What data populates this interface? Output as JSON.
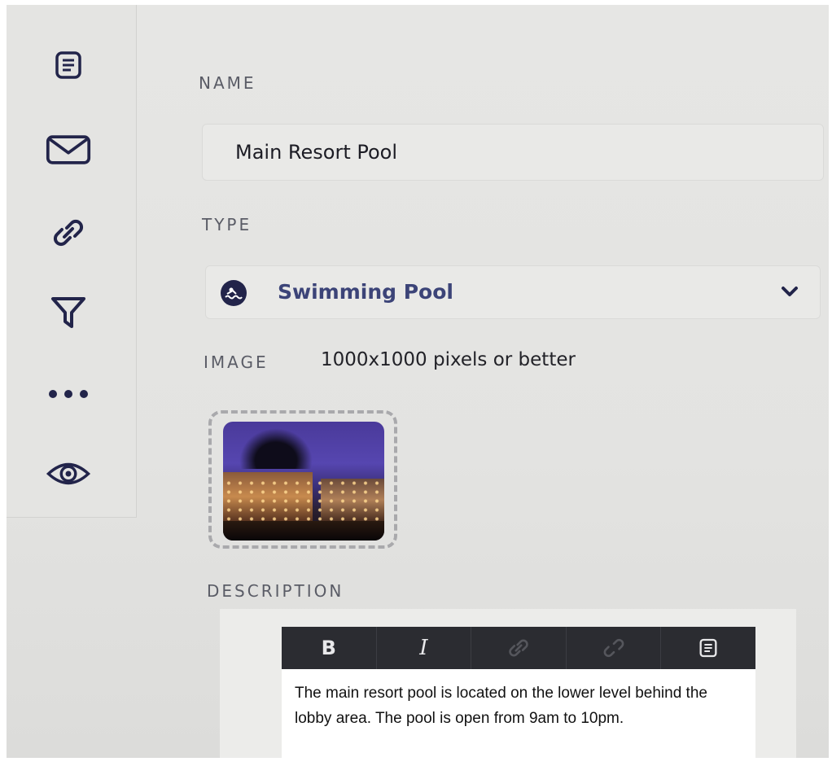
{
  "sidebar": {
    "items": [
      {
        "icon": "document-icon",
        "name": "sidebar-item-details"
      },
      {
        "icon": "envelope-icon",
        "name": "sidebar-item-messages"
      },
      {
        "icon": "link-icon",
        "name": "sidebar-item-links"
      },
      {
        "icon": "filter-icon",
        "name": "sidebar-item-filter"
      },
      {
        "icon": "more-icon",
        "name": "sidebar-item-more"
      },
      {
        "icon": "eye-icon",
        "name": "sidebar-item-preview"
      }
    ]
  },
  "form": {
    "name_label": "NAME",
    "name_value": "Main Resort Pool",
    "type_label": "TYPE",
    "type_value": "Swimming Pool",
    "type_icon": "swimming-pool-icon",
    "image_label": "IMAGE",
    "image_hint": "1000x1000 pixels or better",
    "description_label": "DESCRIPTION"
  },
  "editor": {
    "toolbar": [
      {
        "name": "bold-button",
        "label": "B"
      },
      {
        "name": "italic-button",
        "label": "I"
      },
      {
        "name": "link-button",
        "icon": "link-icon"
      },
      {
        "name": "unlink-button",
        "icon": "unlink-icon"
      },
      {
        "name": "source-button",
        "icon": "document-icon"
      }
    ],
    "text": "The main resort pool is located on the lower level behind the lobby area. The pool is open from 9am to 10pm."
  },
  "colors": {
    "background": "#e4e4e2",
    "label": "#5a5c66",
    "accent": "#3c4478",
    "icon": "#22244a",
    "toolbar": "#2b2c31"
  }
}
